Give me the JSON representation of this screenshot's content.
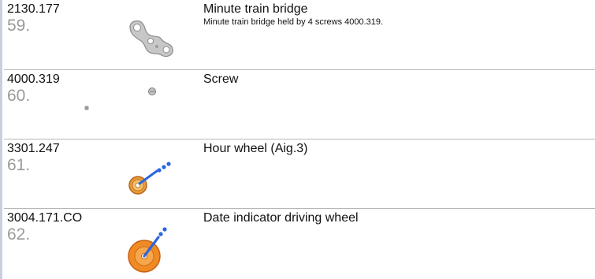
{
  "parts": [
    {
      "ref": "2130.177",
      "index": "59.",
      "title": "Minute train bridge",
      "description": "Minute train bridge held by 4 screws 4000.319.",
      "image": "bridge-part-icon"
    },
    {
      "ref": "4000.319",
      "index": "60.",
      "title": "Screw",
      "description": "",
      "image": "screw-icon"
    },
    {
      "ref": "3301.247",
      "index": "61.",
      "title": "Hour wheel (Aig.3)",
      "description": "",
      "image": "hour-wheel-icon"
    },
    {
      "ref": "3004.171.CO",
      "index": "62.",
      "title": "Date indicator driving wheel",
      "description": "",
      "image": "date-wheel-icon"
    }
  ],
  "colors": {
    "index_text": "#9a9a9a",
    "separator": "#b7b7b7",
    "left_rule": "#c9cfe0",
    "wheel_orange": "#e8801f",
    "pointer_blue": "#2a67e0",
    "metal_gray": "#b8b8b8"
  }
}
